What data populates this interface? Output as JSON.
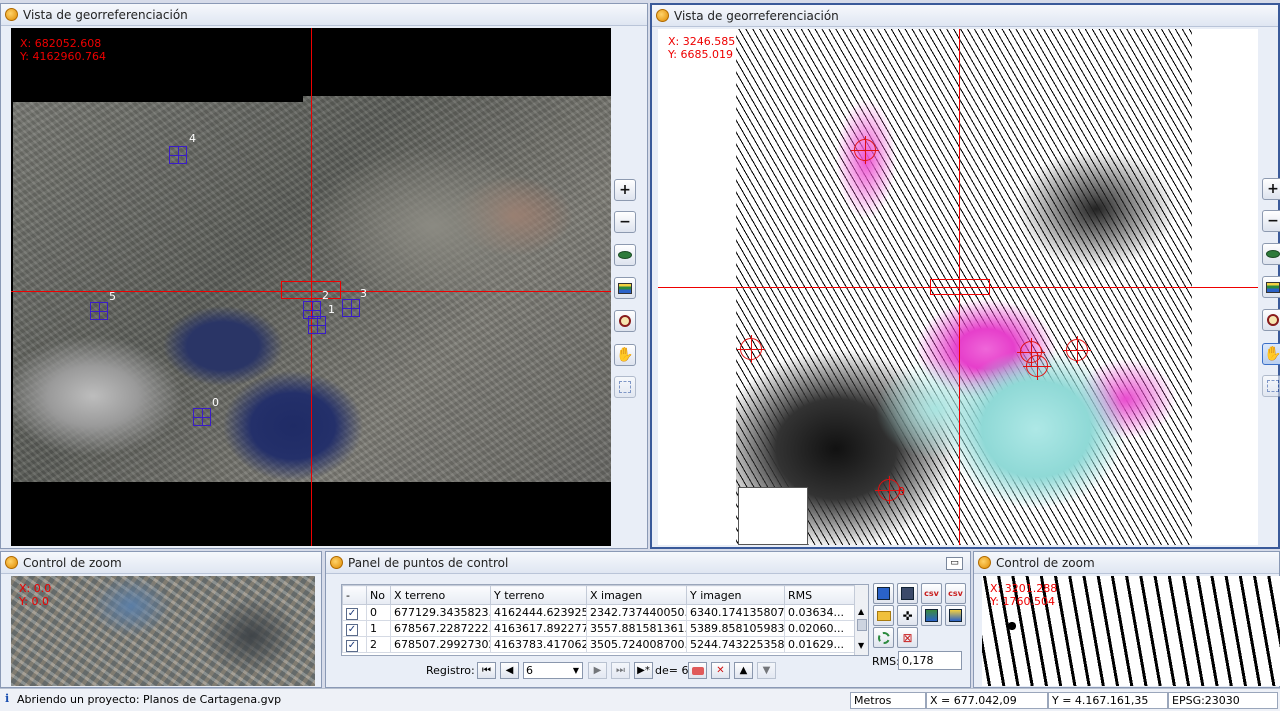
{
  "left_view": {
    "title": "Vista de georreferenciación",
    "coord_x": "X: 682052.608",
    "coord_y": "Y: 4162960.764",
    "point_labels": [
      "0",
      "1",
      "2",
      "3",
      "4",
      "5"
    ]
  },
  "right_view": {
    "title": "Vista de georreferenciación",
    "coord_x": "X: 3246.585",
    "coord_y": "Y: 6685.019",
    "point_labels": [
      "0",
      "4"
    ]
  },
  "toolbar": {
    "zoom_in": "+",
    "zoom_out": "−",
    "icons": [
      "zoom-in-icon",
      "zoom-out-icon",
      "eye-icon",
      "layers-icon",
      "magnifier-icon",
      "pan-hand-icon",
      "full-extent-icon"
    ]
  },
  "zoom_left": {
    "title": "Control de zoom",
    "coord_x": "X: 0.0",
    "coord_y": "Y: 0.0"
  },
  "zoom_right": {
    "title": "Control de zoom",
    "coord_x": "X: 3201.288",
    "coord_y": "Y: 1760.504"
  },
  "control_points": {
    "title": "Panel de puntos de control",
    "headers": [
      "-",
      "No",
      "X terreno",
      "Y terreno",
      "X imagen",
      "Y imagen",
      "RMS"
    ],
    "rows": [
      {
        "checked": "✓",
        "no": "0",
        "x_terreno": "677129.3435823...",
        "y_terreno": "4162444.62392574",
        "x_imagen": "2342.737440050...",
        "y_imagen": "6340.174135807...",
        "rms": "0.03634..."
      },
      {
        "checked": "✓",
        "no": "1",
        "x_terreno": "678567.2287222...",
        "y_terreno": "4163617.892277...",
        "x_imagen": "3557.881581361...",
        "y_imagen": "5389.858105983...",
        "rms": "0.02060..."
      },
      {
        "checked": "✓",
        "no": "2",
        "x_terreno": "678507.299273025",
        "y_terreno": "4163783.417062...",
        "x_imagen": "3505.724008700...",
        "y_imagen": "5244.743225358...",
        "rms": "0.01629..."
      }
    ],
    "registro_label": "Registro:",
    "registro_value": "6",
    "de_label": "de= 6",
    "rms_label": "RMS:",
    "rms_value": "0,178",
    "side_icons": [
      "save-icon",
      "save-as-icon",
      "csv-import-icon",
      "csv-export-icon",
      "folder-icon",
      "center-icon",
      "layer-export-icon",
      "layer-import-icon",
      "settings-icon",
      "clear-icon"
    ]
  },
  "status": {
    "message": "Abriendo un proyecto: Planos de Cartagena.gvp",
    "units": "Metros",
    "x": "X = 677.042,09",
    "y": "Y = 4.167.161,35",
    "epsg": "EPSG:23030"
  },
  "colors": {
    "crosshair": "#e00000",
    "point_marker": "#3a1cc9",
    "magenta_overlay": "#e020c0",
    "frame_border": "#8a99b5"
  }
}
